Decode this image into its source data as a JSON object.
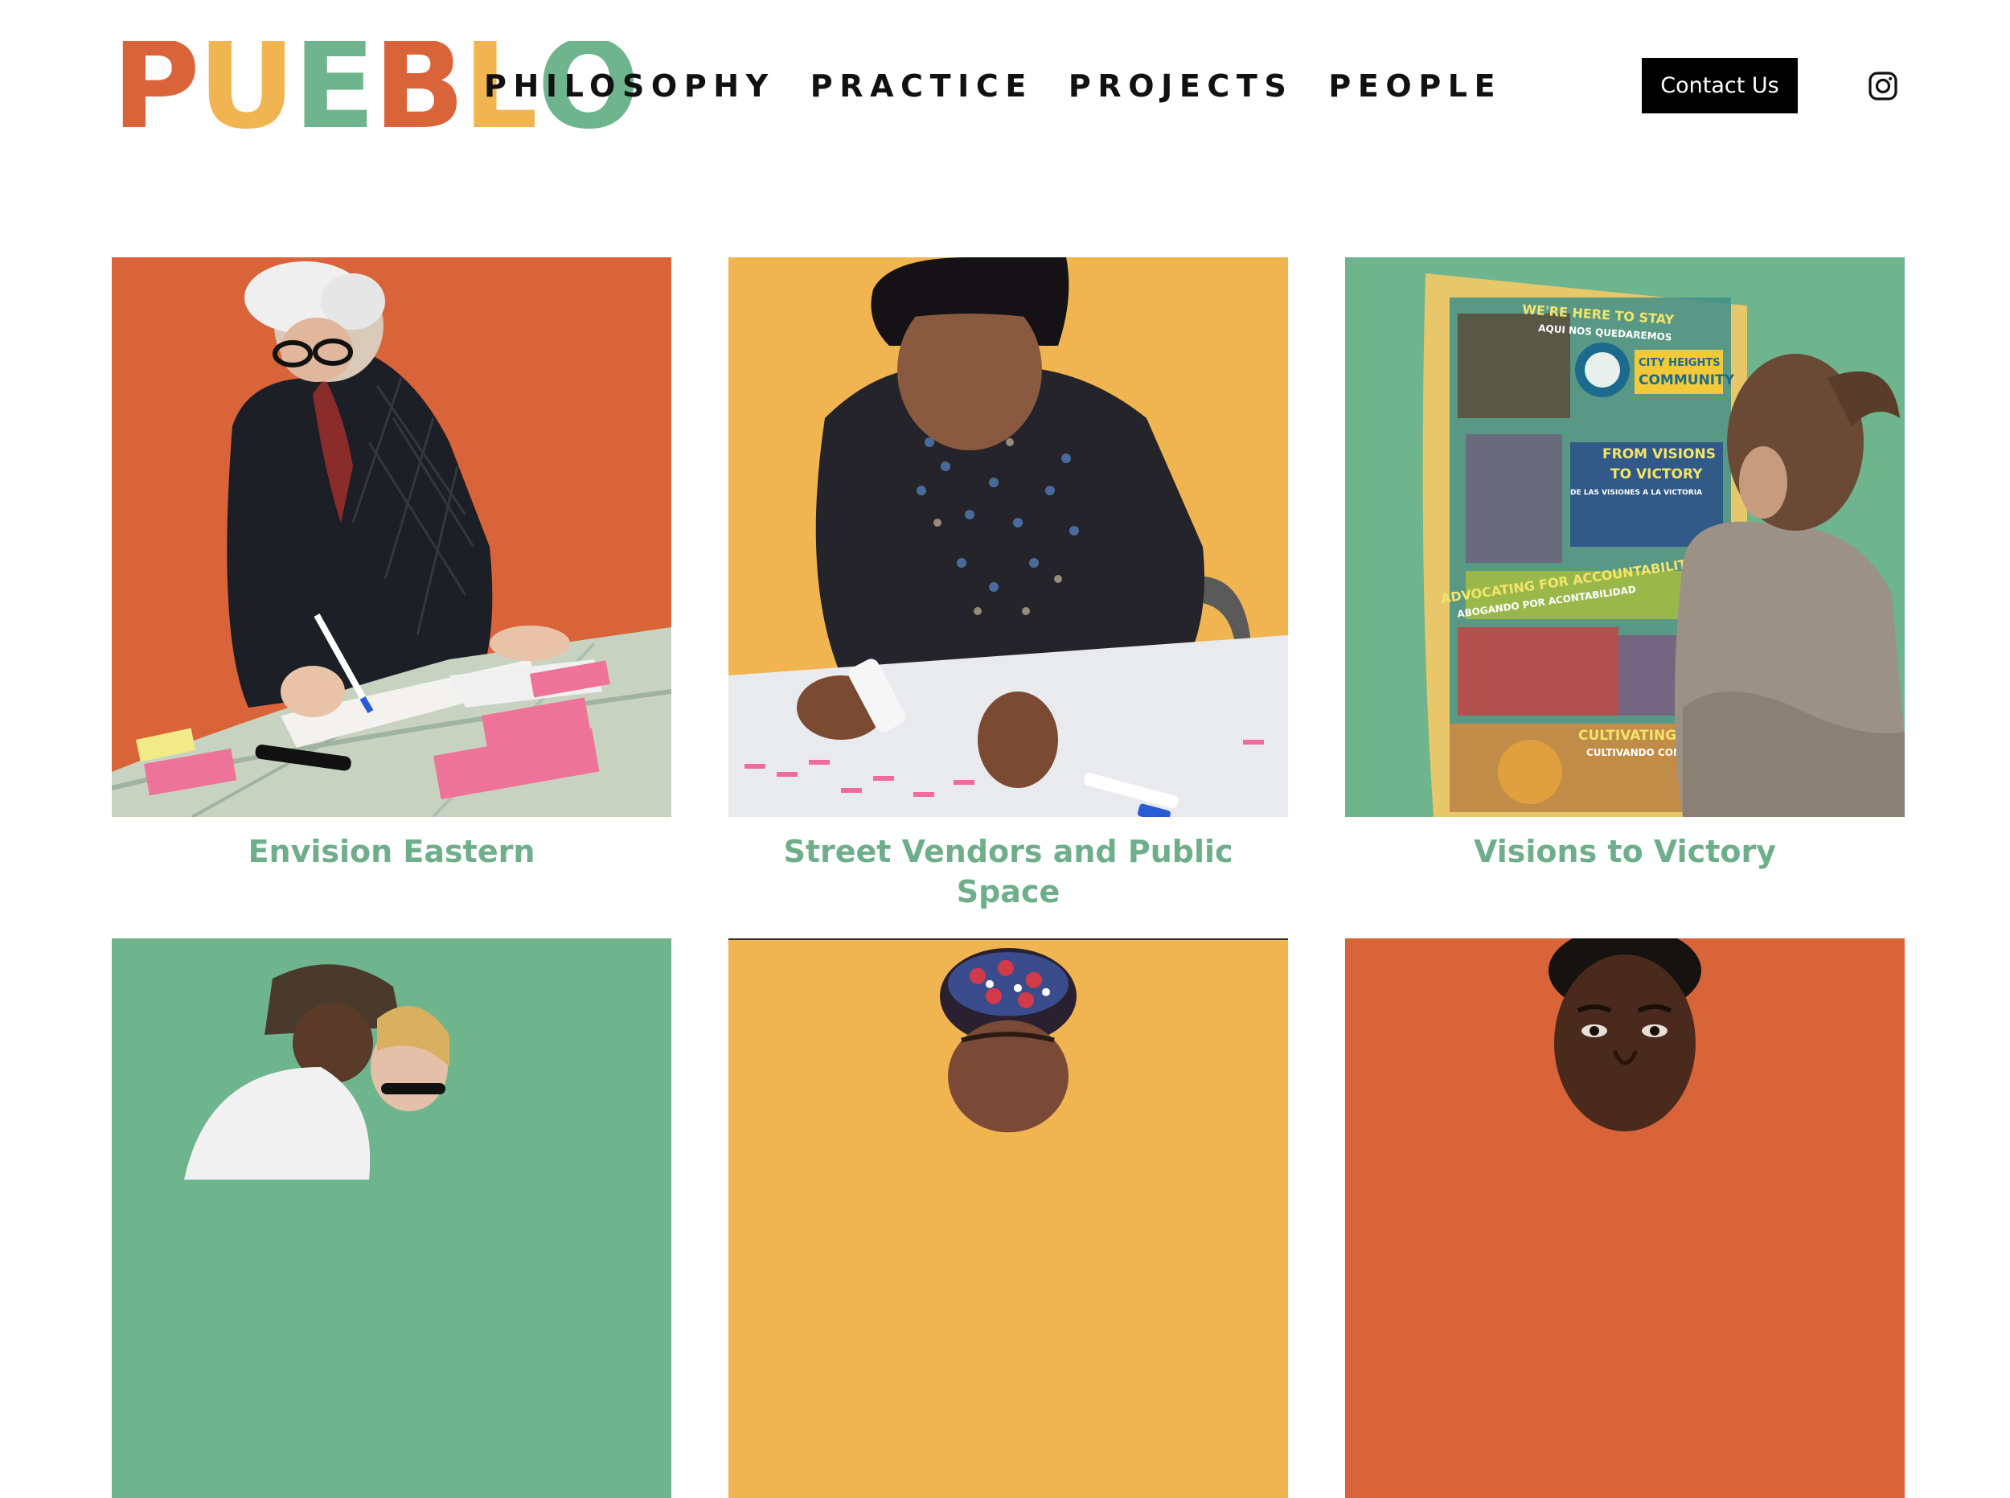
{
  "brand": {
    "letters": [
      {
        "char": "P",
        "color": "#d9643a"
      },
      {
        "char": "U",
        "color": "#f0b450"
      },
      {
        "char": "E",
        "color": "#6eb48c"
      },
      {
        "char": "B",
        "color": "#d9643a"
      },
      {
        "char": "L",
        "color": "#f0b450"
      },
      {
        "char": "O",
        "color": "#6eb48c"
      }
    ]
  },
  "nav": {
    "items": [
      "PHILOSOPHY",
      "PRACTICE",
      "PROJECTS",
      "PEOPLE"
    ]
  },
  "header": {
    "contact_label": "Contact Us",
    "social_icon": "instagram-icon"
  },
  "colors": {
    "orange": "#d9643a",
    "yellow": "#f0b450",
    "green": "#6eb48c",
    "title_green": "#6fae8a"
  },
  "projects": [
    {
      "title": "Envision Eastern",
      "bg": "#d9643a"
    },
    {
      "title": "Street Vendors and Public Space",
      "bg": "#f0b450"
    },
    {
      "title": "Visions to Victory",
      "bg": "#6eb48c"
    },
    {
      "title": "",
      "bg": "#6eb48c"
    },
    {
      "title": "",
      "bg": "#f0b450"
    },
    {
      "title": "",
      "bg": "#d9643a"
    }
  ],
  "poster": {
    "lines": [
      "WE'RE HERE TO STAY",
      "AQUI NOS QUEDAREMOS",
      "CITY HEIGHTS",
      "COMMUNITY",
      "FROM VISIONS",
      "TO VICTORY",
      "DE LAS VISIONES A LA VICTORIA",
      "ADVOCATING FOR ACCOUNTABILITY",
      "ABOGANDO POR ACONTABILIDAD",
      "CULTIVATING COMI",
      "CULTIVANDO COMUN"
    ]
  }
}
